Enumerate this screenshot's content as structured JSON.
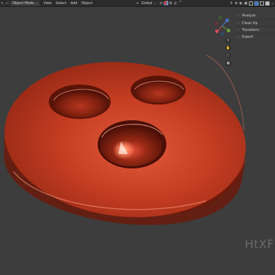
{
  "topbar": {
    "mode_label": "Object Mode",
    "menu": [
      "View",
      "Select",
      "Add",
      "Object"
    ],
    "transform_orientation": "Global"
  },
  "side_panel": {
    "items": [
      {
        "label": "Analyze",
        "icon": "chevron-right-icon"
      },
      {
        "label": "Clean Up",
        "icon": "chevron-right-icon"
      },
      {
        "label": "Transform",
        "icon": "chevron-right-icon"
      },
      {
        "label": "Export",
        "icon": "chevron-right-icon"
      }
    ]
  },
  "gizmo": {
    "z_label": "Z"
  },
  "watermark": "HtXF",
  "colors": {
    "background": "#3d3d3d",
    "header": "#2b2b2b",
    "model": "#c2381f",
    "axis_x": "#e04b59",
    "axis_y": "#6ea33b",
    "axis_z": "#4a7ed6"
  }
}
